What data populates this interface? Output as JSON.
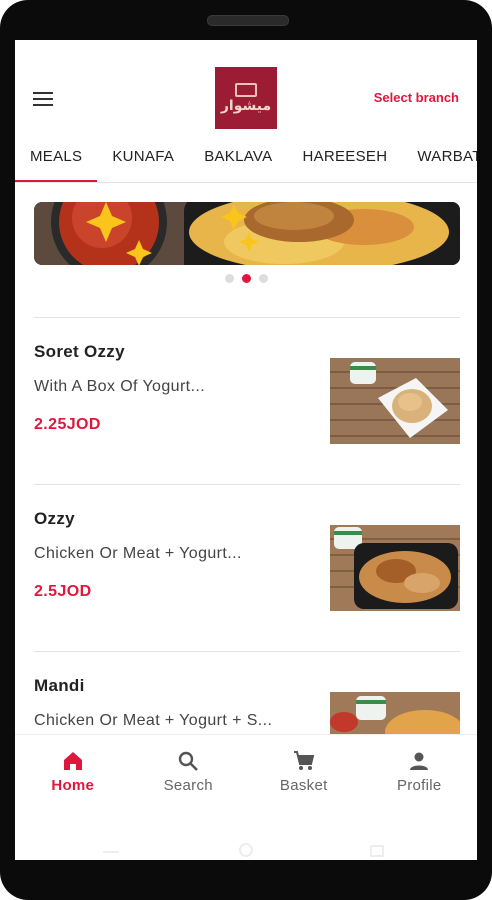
{
  "header": {
    "select_branch": "Select branch",
    "logo_text": "ميشوار"
  },
  "tabs": [
    {
      "label": "MEALS"
    },
    {
      "label": "KUNAFA"
    },
    {
      "label": "BAKLAVA"
    },
    {
      "label": "HAREESEH"
    },
    {
      "label": "WARBAT"
    }
  ],
  "carousel": {
    "active_index": 1,
    "count": 3
  },
  "menu_items": [
    {
      "name": "Soret Ozzy",
      "description": "With A Box Of Yogurt...",
      "price": "2.25JOD"
    },
    {
      "name": "Ozzy",
      "description": "Chicken Or Meat + Yogurt...",
      "price": "2.5JOD"
    },
    {
      "name": "Mandi",
      "description": "Chicken Or Meat + Yogurt + S...",
      "price": ""
    }
  ],
  "bottom_nav": {
    "home": "Home",
    "search": "Search",
    "basket": "Basket",
    "profile": "Profile"
  },
  "colors": {
    "accent": "#e0173d",
    "brand": "#9c1b35"
  }
}
